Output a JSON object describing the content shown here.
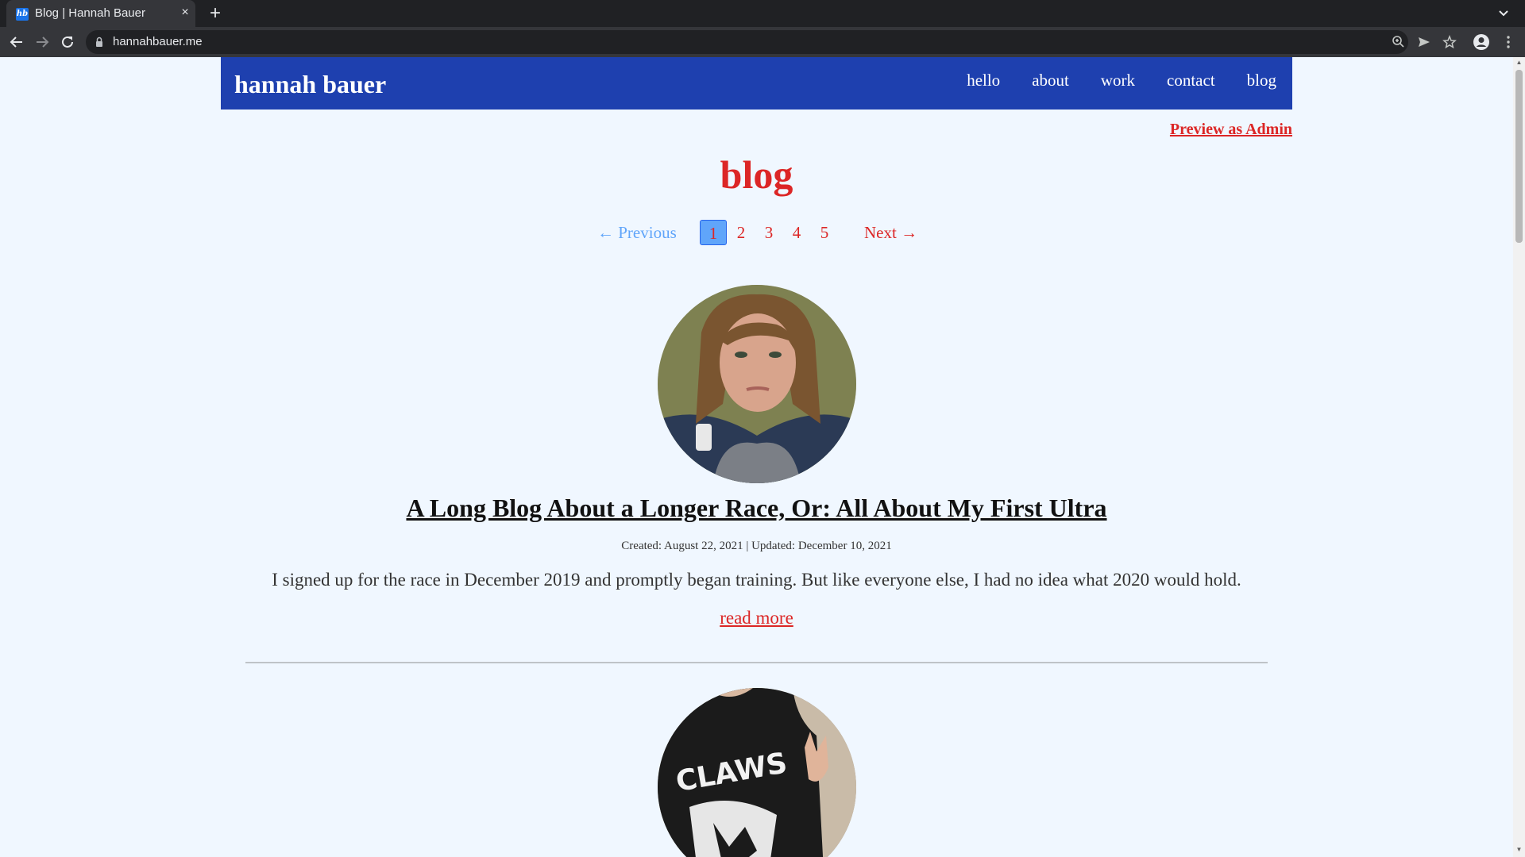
{
  "browser": {
    "tab": {
      "title": "Blog | Hannah Bauer",
      "favicon_text": "hb",
      "close_glyph": "×"
    },
    "new_tab_glyph": "+",
    "address": {
      "url": "hannahbauer.me"
    },
    "icons": [
      "back-icon",
      "forward-icon",
      "reload-icon",
      "lock-icon",
      "zoom-icon",
      "send-icon",
      "star-icon",
      "profile-icon",
      "menu-icon",
      "chevron-down-icon"
    ]
  },
  "site": {
    "brand": "hannah bauer",
    "nav": [
      "hello",
      "about",
      "work",
      "contact",
      "blog"
    ]
  },
  "admin_link": "Preview as Admin",
  "page_title": "blog",
  "pagination": {
    "previous": "← Previous",
    "pages": [
      "1",
      "2",
      "3",
      "4",
      "5"
    ],
    "current": "1",
    "next": "Next →"
  },
  "posts": [
    {
      "title": "A Long Blog About a Longer Race, Or: All About My First Ultra",
      "meta": "Created: August 22, 2021 | Updated: December 10, 2021",
      "excerpt": "I signed up for the race in December 2019 and promptly began training. But like everyone else, I had no idea what 2020 would hold.",
      "read_more": "read more"
    }
  ],
  "second_post_image_text": "CLAWS",
  "colors": {
    "header_bg": "#1e40af",
    "accent_red": "#dc2626",
    "pager_blue": "#60a5fa",
    "page_bg": "#f0f7ff"
  }
}
